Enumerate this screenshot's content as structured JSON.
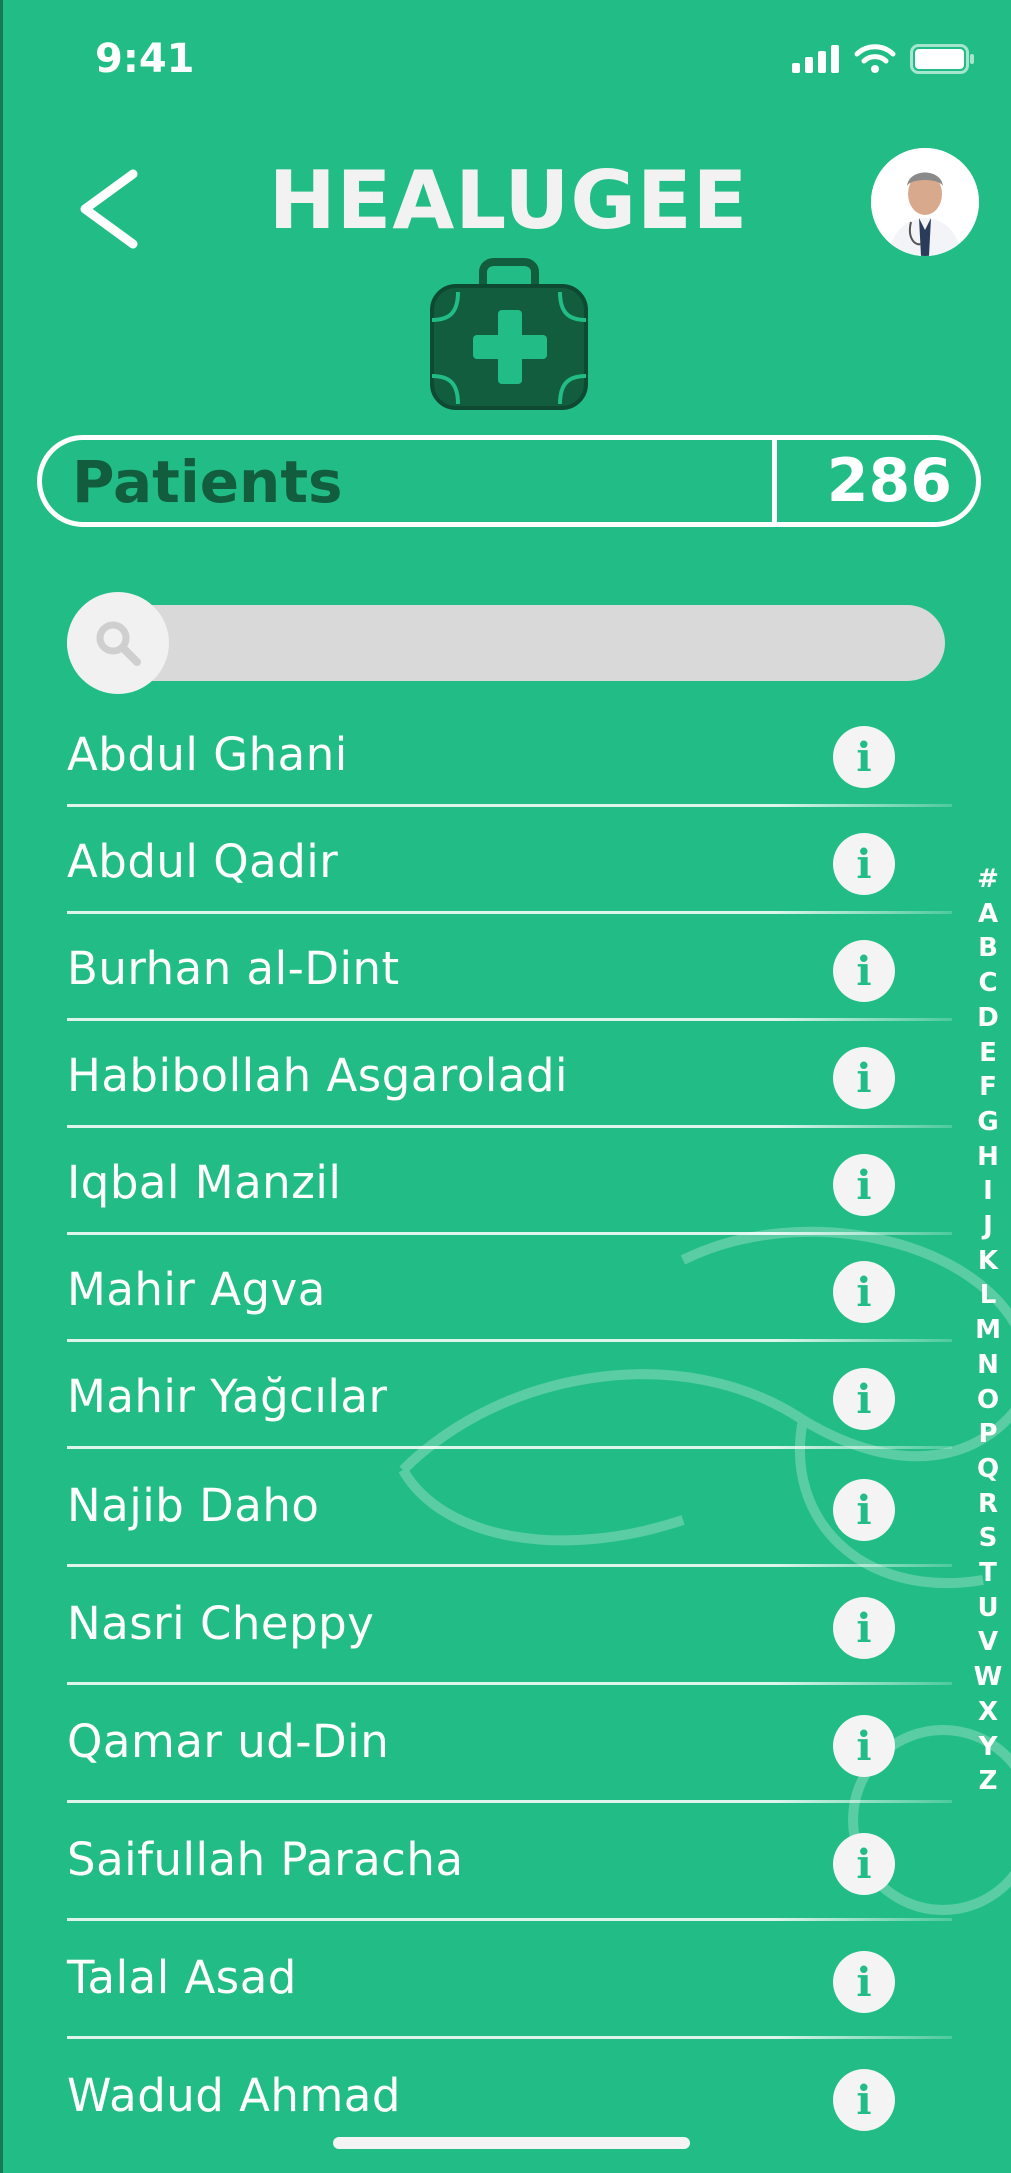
{
  "status_bar": {
    "time": "9:41",
    "icons": [
      "signal-icon",
      "wifi-icon",
      "battery-icon"
    ]
  },
  "header": {
    "back_icon": "chevron-left-icon",
    "title": "HEALUGEE",
    "avatar": "doctor-avatar"
  },
  "logo_icon": "medical-kit-icon",
  "patients": {
    "label": "Patients",
    "count": "286"
  },
  "search": {
    "icon": "search-icon",
    "placeholder": ""
  },
  "list": {
    "items": [
      {
        "name": "Abdul Ghani"
      },
      {
        "name": "Abdul Qadir"
      },
      {
        "name": "Burhan al-Dint"
      },
      {
        "name": "Habibollah Asgaroladi"
      },
      {
        "name": "Iqbal Manzil"
      },
      {
        "name": "Mahir Agva"
      },
      {
        "name": "Mahir Yağcılar"
      },
      {
        "name": "Najib Daho"
      },
      {
        "name": "Nasri Cheppy"
      },
      {
        "name": "Qamar ud-Din"
      },
      {
        "name": "Saifullah Paracha"
      },
      {
        "name": "Talal Asad"
      },
      {
        "name": "Wadud Ahmad"
      }
    ],
    "info_glyph": "i"
  },
  "alpha_index": [
    "#",
    "A",
    "B",
    "C",
    "D",
    "E",
    "F",
    "G",
    "H",
    "I",
    "J",
    "K",
    "L",
    "M",
    "N",
    "O",
    "P",
    "Q",
    "R",
    "S",
    "T",
    "U",
    "V",
    "W",
    "X",
    "Y",
    "Z"
  ],
  "colors": {
    "background": "#22bd87",
    "dark_green": "#125d3e",
    "white": "#ffffff",
    "search_bg": "#d9d9d9"
  }
}
